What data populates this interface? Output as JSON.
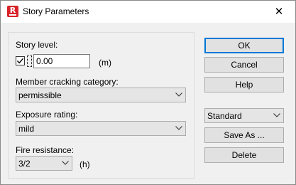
{
  "window": {
    "title": "Story Parameters",
    "app_icon_letter": "R",
    "close_symbol": "✕"
  },
  "form": {
    "story_level": {
      "label": "Story level:",
      "checked": true,
      "value": "0.00",
      "unit": "(m)"
    },
    "member_cracking": {
      "label": "Member cracking category:",
      "selected": "permissible"
    },
    "exposure": {
      "label": "Exposure rating:",
      "selected": "mild"
    },
    "fire": {
      "label": "Fire resistance:",
      "selected": "3/2",
      "unit": "(h)"
    }
  },
  "buttons": {
    "ok": "OK",
    "cancel": "Cancel",
    "help": "Help",
    "save_as": "Save As ...",
    "delete": "Delete"
  },
  "preset": {
    "selected": "Standard"
  },
  "icons": {
    "close": "close-icon",
    "checkbox": "checkmark-icon",
    "dropdown": "chevron-down-icon"
  }
}
